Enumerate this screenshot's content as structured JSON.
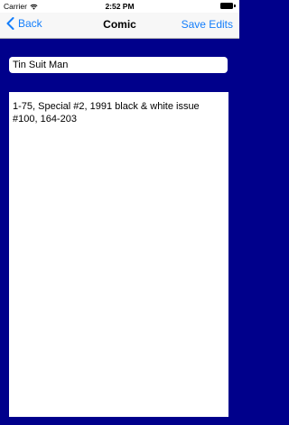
{
  "status_bar": {
    "carrier": "Carrier",
    "time": "2:52 PM",
    "icons": [
      "wifi-icon",
      "battery-icon"
    ]
  },
  "nav_bar": {
    "back_label": "Back",
    "title": "Comic",
    "save_label": "Save Edits",
    "accent_color": "#147efb"
  },
  "form": {
    "title_value": "Tin Suit Man",
    "notes_value": "1-75, Special #2, 1991 black & white issue #100, 164-203"
  },
  "colors": {
    "background": "#00008b",
    "field_background": "#ffffff"
  }
}
